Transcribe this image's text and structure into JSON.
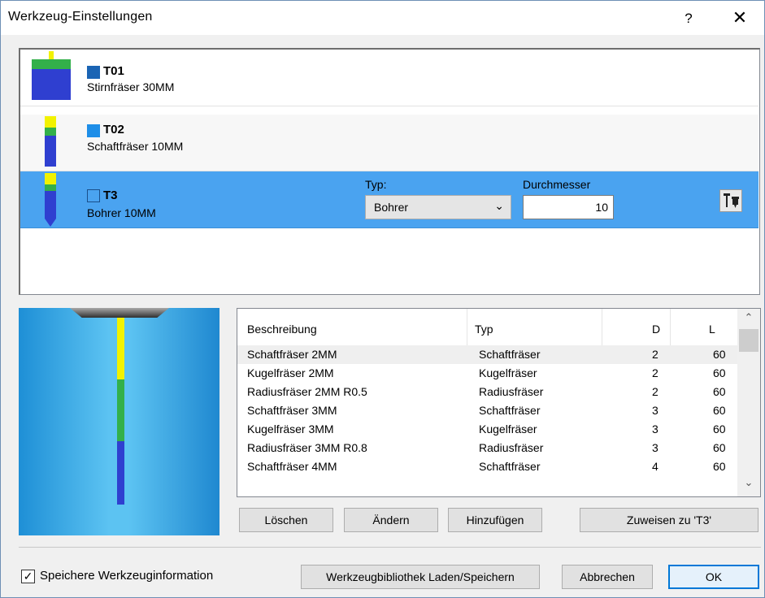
{
  "window": {
    "title": "Werkzeug-Einstellungen",
    "help_glyph": "?",
    "close_glyph": "✕"
  },
  "tools": [
    {
      "name": "T01",
      "description": "Stirnfräser 30MM",
      "color": "#1a64b4"
    },
    {
      "name": "T02",
      "description": "Schaftfräser 10MM",
      "color": "#1e8ee8"
    },
    {
      "name": "T3",
      "description": "Bohrer 10MM",
      "color": "#4aa3f0"
    }
  ],
  "editor": {
    "type_label": "Typ:",
    "type_value": "Bohrer",
    "diameter_label": "Durchmesser",
    "diameter_value": "10"
  },
  "library": {
    "columns": [
      "Beschreibung",
      "Typ",
      "D",
      "L"
    ],
    "rows": [
      [
        "Schaftfräser 2MM",
        "Schaftfräser",
        "2",
        "60"
      ],
      [
        "Kugelfräser 2MM",
        "Kugelfräser",
        "2",
        "60"
      ],
      [
        "Radiusfräser 2MM R0.5",
        "Radiusfräser",
        "2",
        "60"
      ],
      [
        "Schaftfräser 3MM",
        "Schaftfräser",
        "3",
        "60"
      ],
      [
        "Kugelfräser 3MM",
        "Kugelfräser",
        "3",
        "60"
      ],
      [
        "Radiusfräser 3MM R0.8",
        "Radiusfräser",
        "3",
        "60"
      ],
      [
        "Schaftfräser 4MM",
        "Schaftfräser",
        "4",
        "60"
      ]
    ],
    "selected_row": 0
  },
  "library_buttons": {
    "delete": "Löschen",
    "modify": "Ändern",
    "add": "Hinzufügen",
    "assign": "Zuweisen zu 'T3'"
  },
  "footer": {
    "save_checkbox_label": "Speichere Werkzeuginformation",
    "save_checkbox_checked": true,
    "load_save_button": "Werkzeugbibliothek Laden/Speichern",
    "cancel_button": "Abbrechen",
    "ok_button": "OK"
  },
  "icons": [
    "help-icon",
    "close-icon",
    "end-mill-icon",
    "drill-icon",
    "tool-library-icon",
    "dropdown-chevron-icon",
    "checkmark-icon",
    "scroll-up-icon",
    "scroll-down-icon"
  ],
  "colors": {
    "selection": "#4aa3f0",
    "accent": "#0078d7",
    "tool_blue": "#2f3fd0",
    "tool_green": "#33b04a",
    "tool_yellow": "#f2f200"
  }
}
